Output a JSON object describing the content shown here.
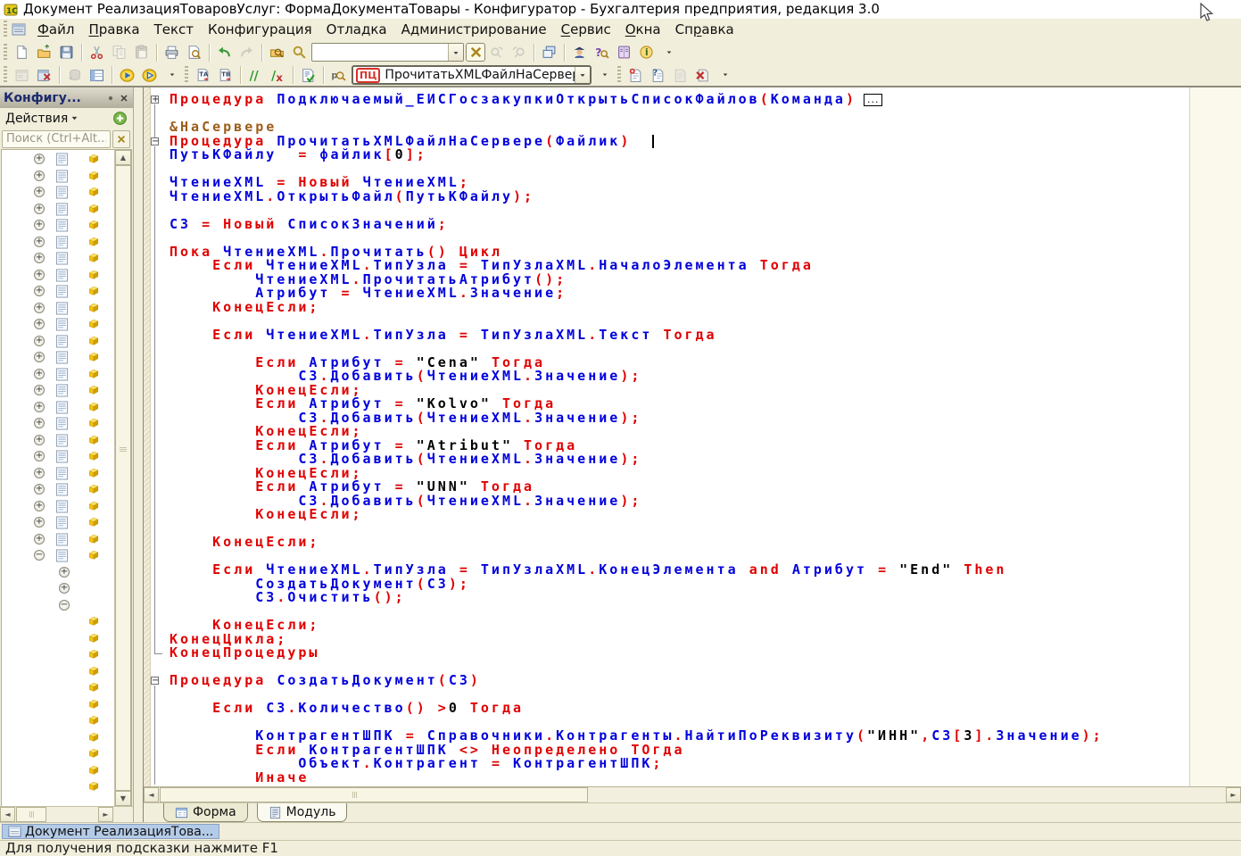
{
  "window": {
    "title": "Документ РеализацияТоваровУслуг: ФормаДокументаТовары - Конфигуратор - Бухгалтерия предприятия, редакция 3.0"
  },
  "colors": {
    "kw": "#e00000",
    "id": "#0000dd",
    "str": "#000000",
    "dir": "#9c5d1a",
    "sel": "#b4cbe8"
  },
  "menu": {
    "items": [
      {
        "name": "file",
        "label": "Файл",
        "u": 0
      },
      {
        "name": "edit",
        "label": "Правка",
        "u": 0
      },
      {
        "name": "text",
        "label": "Текст",
        "u": null
      },
      {
        "name": "configuration",
        "label": "Конфигурация",
        "u": null
      },
      {
        "name": "debug",
        "label": "Отладка",
        "u": null
      },
      {
        "name": "administration",
        "label": "Администрирование",
        "u": null
      },
      {
        "name": "service",
        "label": "Сервис",
        "u": 0
      },
      {
        "name": "windows",
        "label": "Окна",
        "u": 0
      },
      {
        "name": "help",
        "label": "Справка",
        "u": 2
      }
    ]
  },
  "toolbar_main": {
    "search_value": "",
    "items": [
      {
        "grip": true
      },
      {
        "name": "new-document"
      },
      {
        "name": "open-file"
      },
      {
        "name": "save"
      },
      {
        "sep": true
      },
      {
        "name": "cut"
      },
      {
        "name": "copy",
        "disabled": true
      },
      {
        "name": "paste",
        "disabled": true
      },
      {
        "sep": true
      },
      {
        "name": "print"
      },
      {
        "name": "print-preview"
      },
      {
        "sep": true
      },
      {
        "name": "undo"
      },
      {
        "name": "redo",
        "disabled": true
      },
      {
        "sep": true
      },
      {
        "name": "find-in-files"
      },
      {
        "name": "find"
      },
      {
        "search": true
      },
      {
        "name": "clear-search",
        "framed": true
      },
      {
        "name": "find-next",
        "disabled": true
      },
      {
        "name": "find-previous",
        "disabled": true
      },
      {
        "sep": true
      },
      {
        "name": "window-list"
      },
      {
        "sep": true
      },
      {
        "name": "syntax-assistant"
      },
      {
        "name": "context-help"
      },
      {
        "name": "help-contents"
      },
      {
        "name": "about"
      },
      {
        "name": "overflow"
      }
    ]
  },
  "toolbar_config": {
    "combo": {
      "badge": "ПЦ",
      "value": "ПрочитатьXMLФайлНаСервере"
    },
    "items": [
      {
        "grip": true
      },
      {
        "name": "form-editor",
        "disabled": true
      },
      {
        "name": "check-module"
      },
      {
        "sep": true
      },
      {
        "name": "db-history",
        "disabled": true
      },
      {
        "name": "form-table"
      },
      {
        "sep": true
      },
      {
        "name": "start-debugging"
      },
      {
        "name": "run-application"
      },
      {
        "name": "overflow"
      },
      {
        "grip": true
      },
      {
        "name": "template-a"
      },
      {
        "name": "template-b"
      },
      {
        "sep": true
      },
      {
        "name": "comment"
      },
      {
        "name": "uncomment"
      },
      {
        "sep": true
      },
      {
        "name": "syntax-check"
      },
      {
        "sep": true
      },
      {
        "name": "procedures-functions"
      },
      {
        "combo": true
      },
      {
        "name": "overflow"
      },
      {
        "grip": true
      },
      {
        "name": "bookmark-add"
      },
      {
        "name": "bookmark-question"
      },
      {
        "name": "bookmark-prev",
        "disabled": true
      },
      {
        "name": "bookmark-delete"
      },
      {
        "name": "overflow"
      }
    ]
  },
  "sidebar": {
    "title": "Конфигу...",
    "actions_label": "Действия",
    "search_placeholder": "Поиск (Ctrl+Alt...",
    "tree": {
      "pattern": [
        {
          "type": "node-collapsed",
          "count": 24
        },
        {
          "type": "node-expanded",
          "count": 1
        },
        {
          "type": "subnode-collapsed",
          "count": 2
        },
        {
          "type": "subnode-expanded",
          "count": 1
        },
        {
          "type": "leaf",
          "count": 11
        }
      ]
    }
  },
  "editor": {
    "collapsed_marker": "...",
    "cursor": {
      "line": 3,
      "col": 45
    },
    "lines": [
      {
        "f": "p",
        "box": true,
        "s": [
          [
            "k",
            "Процедура "
          ],
          [
            "v",
            "Подключаемый_ЕИСГосзакупкиОткрытьСписокФайлов"
          ],
          [
            "k",
            "("
          ],
          [
            "v",
            "Команда"
          ],
          [
            "k",
            ")"
          ]
        ]
      },
      {
        "f": "l",
        "s": []
      },
      {
        "f": "l",
        "s": [
          [
            "d",
            "&НаСервере"
          ]
        ]
      },
      {
        "f": "m",
        "s": [
          [
            "k",
            "Процедура "
          ],
          [
            "v",
            "ПрочитатьXMLФайлНаСервере"
          ],
          [
            "k",
            "("
          ],
          [
            "v",
            "Файлик"
          ],
          [
            "k",
            ")"
          ]
        ]
      },
      {
        "f": "l",
        "s": [
          [
            "v",
            "ПутьКФайлу  "
          ],
          [
            "k",
            "= "
          ],
          [
            "v",
            "файлик"
          ],
          [
            "k",
            "["
          ],
          [
            "t",
            "0"
          ],
          [
            "k",
            "];"
          ]
        ]
      },
      {
        "f": "l",
        "s": []
      },
      {
        "f": "l",
        "s": [
          [
            "v",
            "ЧтениеXML "
          ],
          [
            "k",
            "= Новый "
          ],
          [
            "v",
            "ЧтениеXML"
          ],
          [
            "k",
            ";"
          ]
        ]
      },
      {
        "f": "l",
        "s": [
          [
            "v",
            "ЧтениеXML"
          ],
          [
            "k",
            "."
          ],
          [
            "v",
            "ОткрытьФайл"
          ],
          [
            "k",
            "("
          ],
          [
            "v",
            "ПутьКФайлу"
          ],
          [
            "k",
            ");"
          ]
        ]
      },
      {
        "f": "l",
        "s": []
      },
      {
        "f": "l",
        "s": [
          [
            "v",
            "СЗ "
          ],
          [
            "k",
            "= Новый "
          ],
          [
            "v",
            "СписокЗначений"
          ],
          [
            "k",
            ";"
          ]
        ]
      },
      {
        "f": "l",
        "s": []
      },
      {
        "f": "l",
        "s": [
          [
            "k",
            "Пока "
          ],
          [
            "v",
            "ЧтениеXML"
          ],
          [
            "k",
            "."
          ],
          [
            "v",
            "Прочитать"
          ],
          [
            "k",
            "() Цикл"
          ]
        ]
      },
      {
        "f": "l",
        "s": [
          [
            "k",
            "    Если "
          ],
          [
            "v",
            "ЧтениеXML"
          ],
          [
            "k",
            "."
          ],
          [
            "v",
            "ТипУзла "
          ],
          [
            "k",
            "= "
          ],
          [
            "v",
            "ТипУзлаXML"
          ],
          [
            "k",
            "."
          ],
          [
            "v",
            "НачалоЭлемента "
          ],
          [
            "k",
            "Тогда"
          ]
        ]
      },
      {
        "f": "l",
        "s": [
          [
            "v",
            "        ЧтениеXML"
          ],
          [
            "k",
            "."
          ],
          [
            "v",
            "ПрочитатьАтрибут"
          ],
          [
            "k",
            "();"
          ]
        ]
      },
      {
        "f": "l",
        "s": [
          [
            "v",
            "        Атрибут "
          ],
          [
            "k",
            "= "
          ],
          [
            "v",
            "ЧтениеXML"
          ],
          [
            "k",
            "."
          ],
          [
            "v",
            "Значение"
          ],
          [
            "k",
            ";"
          ]
        ]
      },
      {
        "f": "l",
        "s": [
          [
            "k",
            "    КонецЕсли;"
          ]
        ]
      },
      {
        "f": "l",
        "s": []
      },
      {
        "f": "l",
        "s": [
          [
            "k",
            "    Если "
          ],
          [
            "v",
            "ЧтениеXML"
          ],
          [
            "k",
            "."
          ],
          [
            "v",
            "ТипУзла "
          ],
          [
            "k",
            "= "
          ],
          [
            "v",
            "ТипУзлаXML"
          ],
          [
            "k",
            "."
          ],
          [
            "v",
            "Текст "
          ],
          [
            "k",
            "Тогда"
          ]
        ]
      },
      {
        "f": "l",
        "s": []
      },
      {
        "f": "l",
        "s": [
          [
            "k",
            "        Если "
          ],
          [
            "v",
            "Атрибут "
          ],
          [
            "k",
            "= "
          ],
          [
            "t",
            "\"Cena\" "
          ],
          [
            "k",
            "Тогда"
          ]
        ]
      },
      {
        "f": "l",
        "s": [
          [
            "v",
            "            СЗ"
          ],
          [
            "k",
            "."
          ],
          [
            "v",
            "Добавить"
          ],
          [
            "k",
            "("
          ],
          [
            "v",
            "ЧтениеXML"
          ],
          [
            "k",
            "."
          ],
          [
            "v",
            "Значение"
          ],
          [
            "k",
            ");"
          ]
        ]
      },
      {
        "f": "l",
        "s": [
          [
            "k",
            "        КонецЕсли;"
          ]
        ]
      },
      {
        "f": "l",
        "s": [
          [
            "k",
            "        Если "
          ],
          [
            "v",
            "Атрибут "
          ],
          [
            "k",
            "= "
          ],
          [
            "t",
            "\"Kolvo\" "
          ],
          [
            "k",
            "Тогда"
          ]
        ]
      },
      {
        "f": "l",
        "s": [
          [
            "v",
            "            СЗ"
          ],
          [
            "k",
            "."
          ],
          [
            "v",
            "Добавить"
          ],
          [
            "k",
            "("
          ],
          [
            "v",
            "ЧтениеXML"
          ],
          [
            "k",
            "."
          ],
          [
            "v",
            "Значение"
          ],
          [
            "k",
            ");"
          ]
        ]
      },
      {
        "f": "l",
        "s": [
          [
            "k",
            "        КонецЕсли;"
          ]
        ]
      },
      {
        "f": "l",
        "s": [
          [
            "k",
            "        Если "
          ],
          [
            "v",
            "Атрибут "
          ],
          [
            "k",
            "= "
          ],
          [
            "t",
            "\"Atribut\" "
          ],
          [
            "k",
            "Тогда"
          ]
        ]
      },
      {
        "f": "l",
        "s": [
          [
            "v",
            "            СЗ"
          ],
          [
            "k",
            "."
          ],
          [
            "v",
            "Добавить"
          ],
          [
            "k",
            "("
          ],
          [
            "v",
            "ЧтениеXML"
          ],
          [
            "k",
            "."
          ],
          [
            "v",
            "Значение"
          ],
          [
            "k",
            ");"
          ]
        ]
      },
      {
        "f": "l",
        "s": [
          [
            "k",
            "        КонецЕсли;"
          ]
        ]
      },
      {
        "f": "l",
        "s": [
          [
            "k",
            "        Если "
          ],
          [
            "v",
            "Атрибут "
          ],
          [
            "k",
            "= "
          ],
          [
            "t",
            "\"UNN\" "
          ],
          [
            "k",
            "Тогда"
          ]
        ]
      },
      {
        "f": "l",
        "s": [
          [
            "v",
            "            СЗ"
          ],
          [
            "k",
            "."
          ],
          [
            "v",
            "Добавить"
          ],
          [
            "k",
            "("
          ],
          [
            "v",
            "ЧтениеXML"
          ],
          [
            "k",
            "."
          ],
          [
            "v",
            "Значение"
          ],
          [
            "k",
            ");"
          ]
        ]
      },
      {
        "f": "l",
        "s": [
          [
            "k",
            "        КонецЕсли;"
          ]
        ]
      },
      {
        "f": "l",
        "s": []
      },
      {
        "f": "l",
        "s": [
          [
            "k",
            "    КонецЕсли;"
          ]
        ]
      },
      {
        "f": "l",
        "s": []
      },
      {
        "f": "l",
        "s": [
          [
            "k",
            "    Если "
          ],
          [
            "v",
            "ЧтениеXML"
          ],
          [
            "k",
            "."
          ],
          [
            "v",
            "ТипУзла "
          ],
          [
            "k",
            "= "
          ],
          [
            "v",
            "ТипУзлаXML"
          ],
          [
            "k",
            "."
          ],
          [
            "v",
            "КонецЭлемента "
          ],
          [
            "k",
            "and "
          ],
          [
            "v",
            "Атрибут "
          ],
          [
            "k",
            "= "
          ],
          [
            "t",
            "\"End\" "
          ],
          [
            "k",
            "Then"
          ]
        ]
      },
      {
        "f": "l",
        "s": [
          [
            "v",
            "        СоздатьДокумент"
          ],
          [
            "k",
            "("
          ],
          [
            "v",
            "СЗ"
          ],
          [
            "k",
            ");"
          ]
        ]
      },
      {
        "f": "l",
        "s": [
          [
            "v",
            "        СЗ"
          ],
          [
            "k",
            "."
          ],
          [
            "v",
            "Очистить"
          ],
          [
            "k",
            "();"
          ]
        ]
      },
      {
        "f": "l",
        "s": []
      },
      {
        "f": "l",
        "s": [
          [
            "k",
            "    КонецЕсли;"
          ]
        ]
      },
      {
        "f": "l",
        "s": [
          [
            "k",
            "КонецЦикла;"
          ]
        ]
      },
      {
        "f": "e",
        "s": [
          [
            "k",
            "КонецПроцедуры"
          ]
        ]
      },
      {
        "f": "n",
        "s": []
      },
      {
        "f": "m2",
        "s": [
          [
            "k",
            "Процедура "
          ],
          [
            "v",
            "СоздатьДокумент"
          ],
          [
            "k",
            "("
          ],
          [
            "v",
            "СЗ"
          ],
          [
            "k",
            ")"
          ]
        ]
      },
      {
        "f": "l",
        "s": []
      },
      {
        "f": "l",
        "s": [
          [
            "k",
            "    Если "
          ],
          [
            "v",
            "СЗ"
          ],
          [
            "k",
            "."
          ],
          [
            "v",
            "Количество"
          ],
          [
            "k",
            "() >"
          ],
          [
            "t",
            "0"
          ],
          [
            "k",
            " Тогда"
          ]
        ]
      },
      {
        "f": "l",
        "s": []
      },
      {
        "f": "l",
        "s": [
          [
            "v",
            "        КонтрагентШПК "
          ],
          [
            "k",
            "= "
          ],
          [
            "v",
            "Справочники"
          ],
          [
            "k",
            "."
          ],
          [
            "v",
            "Контрагенты"
          ],
          [
            "k",
            "."
          ],
          [
            "v",
            "НайтиПоРеквизиту"
          ],
          [
            "k",
            "("
          ],
          [
            "t",
            "\"ИНН\""
          ],
          [
            "k",
            ","
          ],
          [
            "v",
            "СЗ"
          ],
          [
            "k",
            "["
          ],
          [
            "t",
            "3"
          ],
          [
            "k",
            "]."
          ],
          [
            "v",
            "Значение"
          ],
          [
            "k",
            ");"
          ]
        ]
      },
      {
        "f": "l",
        "s": [
          [
            "k",
            "        Если "
          ],
          [
            "v",
            "КонтрагентШПК "
          ],
          [
            "k",
            "<> Неопределено ТОгда"
          ]
        ]
      },
      {
        "f": "l",
        "s": [
          [
            "v",
            "            Объект"
          ],
          [
            "k",
            "."
          ],
          [
            "v",
            "Контрагент "
          ],
          [
            "k",
            "= "
          ],
          [
            "v",
            "КонтрагентШПК"
          ],
          [
            "k",
            ";"
          ]
        ]
      },
      {
        "f": "l",
        "s": [
          [
            "k",
            "        Иначе"
          ]
        ]
      }
    ]
  },
  "tabs": [
    {
      "name": "form",
      "label": "Форма",
      "active": false
    },
    {
      "name": "module",
      "label": "Модуль",
      "active": true
    }
  ],
  "taskbar": {
    "items": [
      {
        "label": "Документ РеализацияТова...",
        "selected": true
      }
    ]
  },
  "statusbar": {
    "text": "Для получения подсказки нажмите F1"
  }
}
